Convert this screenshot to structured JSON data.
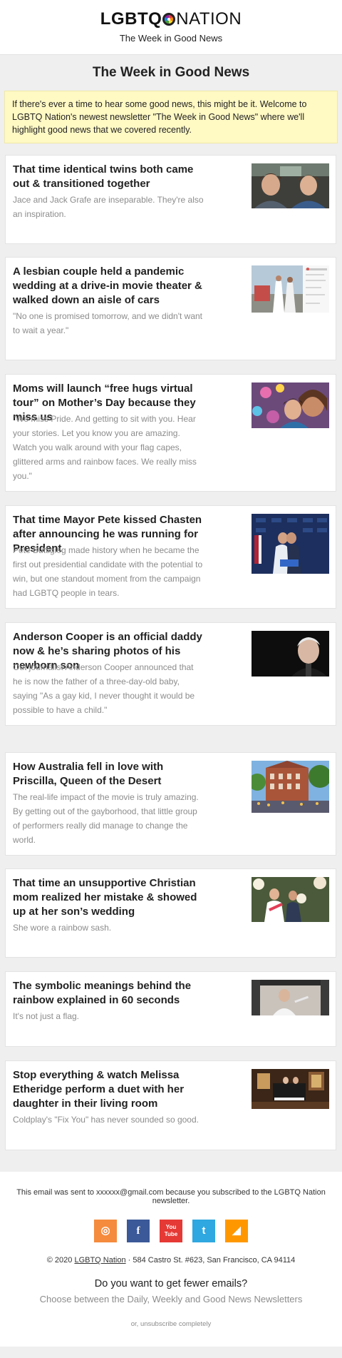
{
  "header": {
    "logo_bold": "LGBTQ",
    "logo_light": "NATION",
    "tagline": "The Week in Good News"
  },
  "page_title": "The Week in Good News",
  "intro": "If there's ever a time to hear some good news, this might be it. Welcome to LGBTQ Nation's newest newsletter \"The Week in Good News\" where we'll highlight good news that we covered recently.",
  "stories": [
    {
      "title": "That time identical twins both came out & transitioned together",
      "desc": "Jace and Jack Grafe are inseparable. They're also an inspiration.",
      "image": "twins-in-car-photo"
    },
    {
      "title": "A lesbian couple held a pandemic wedding at a drive-in movie theater & walked down an aisle of cars",
      "desc": "\"No one is promised tomorrow, and we didn't want to wait a year.\"",
      "image": "drive-in-wedding-photo"
    },
    {
      "title": "Moms will launch “free hugs virtual tour” on Mother’s Day because they miss us",
      "desc": "\"We miss Pride. And getting to sit with you. Hear your stories. Let you know you are amazing. Watch you walk around with your flag capes, glittered arms and rainbow faces. We really miss you.\"",
      "image": "free-hugs-photo"
    },
    {
      "title": "That time Mayor Pete kissed Chasten after announcing he was running for President",
      "desc": "Pete Buttigieg made history when he became the first out presidential candidate with the potential to win, but one standout moment from the campaign had LGBTQ people in tears.",
      "image": "campaign-stage-photo"
    },
    {
      "title": "Anderson Cooper is an official daddy now & he’s sharing photos of his newborn son",
      "desc": "Out journalist Anderson Cooper announced that he is now the father of a three-day-old baby, saying \"As a gay kid, I never thought it would be possible to have a child.\"",
      "image": "anderson-cooper-photo"
    },
    {
      "title": "How Australia fell in love with Priscilla, Queen of the Desert",
      "desc": "The real-life impact of the movie is truly amazing. By getting out of the gayborhood, that little group of performers really did manage to change the world.",
      "image": "street-parade-photo"
    },
    {
      "title": "That time an unsupportive Christian mom realized her mistake & showed up at her son’s wedding",
      "desc": "She wore a rainbow sash.",
      "image": "wedding-photo"
    },
    {
      "title": "The symbolic meanings behind the rainbow explained in 60 seconds",
      "desc": "It's not just a flag.",
      "image": "rainbow-video-photo"
    },
    {
      "title": "Stop everything & watch Melissa Etheridge perform a duet with her daughter in their living room",
      "desc": "Coldplay's \"Fix You\" has never sounded so good.",
      "image": "living-room-piano-photo"
    }
  ],
  "footer": {
    "notice": "This email was sent to xxxxxx@gmail.com because you subscribed to the LGBTQ Nation newsletter.",
    "social": [
      "instagram-icon",
      "facebook-icon",
      "youtube-icon",
      "twitter-icon",
      "rss-icon"
    ],
    "social_glyphs": [
      "◎",
      "f",
      "You Tube",
      "t",
      "◢"
    ],
    "social_colors": [
      "#f58b3d",
      "#3b5998",
      "#e53935",
      "#2fa7e0",
      "#ff9800"
    ],
    "copyright_prefix": "© 2020 ",
    "copyright_link": "LGBTQ Nation",
    "copyright_suffix": " · 584 Castro St. #623, San Francisco, CA 94114",
    "fewer": "Do you want to get fewer emails?",
    "choose": "Choose between the Daily, Weekly and Good News Newsletters",
    "unsubscribe": "or, unsubscribe completely"
  }
}
